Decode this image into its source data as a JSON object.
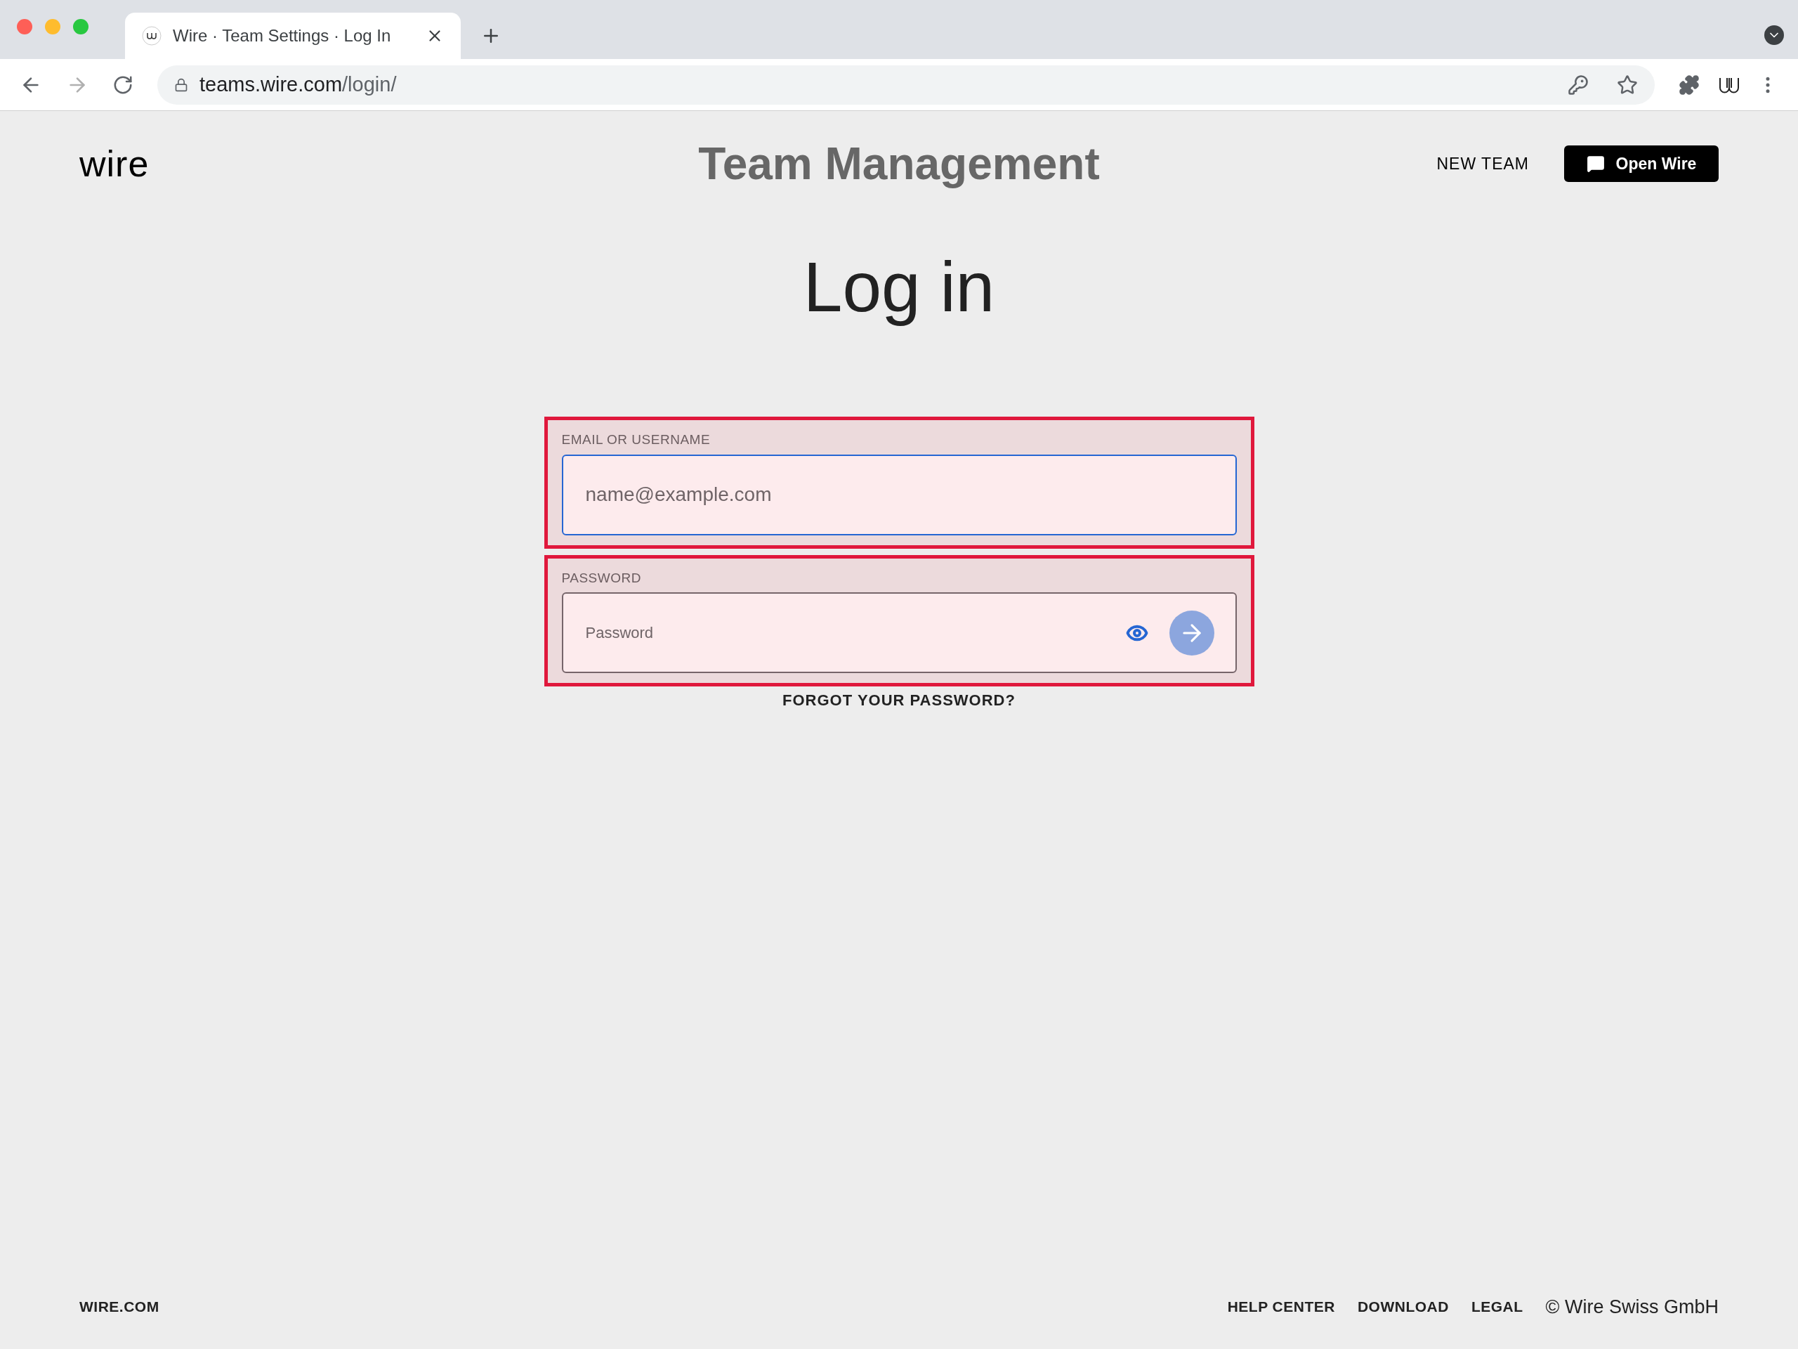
{
  "browser": {
    "tab": {
      "title": "Wire · Team Settings · Log In"
    },
    "url": {
      "host": "teams.wire.com",
      "path": "/login/"
    }
  },
  "header": {
    "logo": "wire",
    "title": "Team Management",
    "new_team": "NEW TEAM",
    "open_button": "Open Wire"
  },
  "heading": "Log in",
  "fields": [
    {
      "kind": "email",
      "label": "EMAIL OR USERNAME",
      "placeholder": "name@example.com",
      "focused": true,
      "highlighted": true
    },
    {
      "kind": "password",
      "label": "PASSWORD",
      "placeholder": "Password",
      "focused": false,
      "highlighted": true
    }
  ],
  "forgot_link": "FORGOT YOUR PASSWORD?",
  "footer": {
    "site_link": "WIRE.COM",
    "links": [
      "HELP CENTER",
      "DOWNLOAD",
      "LEGAL"
    ],
    "copyright": "© Wire Swiss GmbH"
  }
}
